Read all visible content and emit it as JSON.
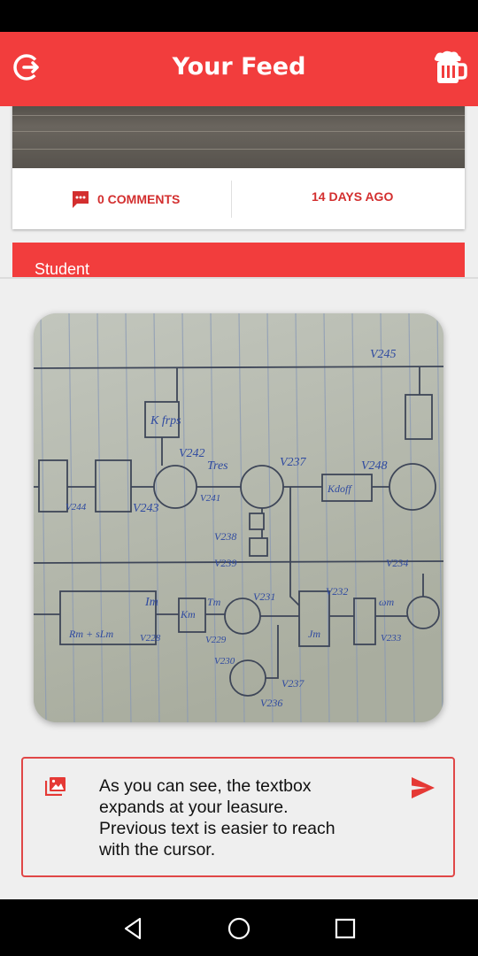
{
  "app": {
    "title": "Your Feed",
    "logout_icon": "logout-icon",
    "beer_icon": "beer-mug-icon",
    "accent_color": "#f23d3d"
  },
  "feed": {
    "post": {
      "comments_label": "0 COMMENTS",
      "comment_icon": "comment-icon",
      "age_label": "14 DAYS AGO"
    },
    "next_post": {
      "author": "Student"
    }
  },
  "preview": {
    "image_icon": "image-icon",
    "sketch_labels": [
      "V245",
      "K frps",
      "V242",
      "Tres",
      "V237",
      "V248",
      "V244",
      "V243",
      "V241",
      "Kdoff",
      "V238",
      "V239",
      "V234",
      "V231",
      "V232",
      "Im",
      "Km",
      "Tm",
      "V228",
      "V229",
      "V233",
      "V230",
      "V237",
      "V236",
      "Rm + sLm",
      "Jm",
      "ωm"
    ]
  },
  "composer": {
    "text": "As you can see, the textbox\nexpands at your leasure.\nPrevious text is easier to reach\nwith the cursor.",
    "attach_icon": "image-icon",
    "send_icon": "send-icon"
  },
  "navbar": {
    "back_icon": "back-icon",
    "home_icon": "home-icon",
    "recents_icon": "recents-icon"
  }
}
